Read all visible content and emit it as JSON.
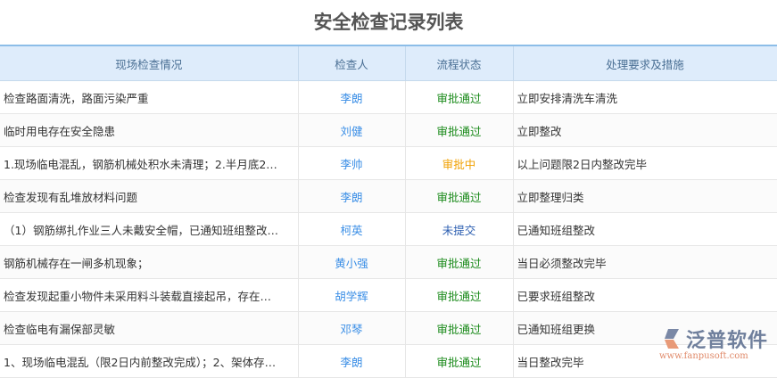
{
  "title": "安全检查记录列表",
  "columns": [
    "现场检查情况",
    "检查人",
    "流程状态",
    "处理要求及措施"
  ],
  "status_colors": {
    "审批通过": "#1a8a1a",
    "审批中": "#f0a000",
    "未提交": "#2a5db0"
  },
  "rows": [
    {
      "situation": "检查路面清洗，路面污染严重",
      "inspector": "李朗",
      "status": "审批通过",
      "measure": "立即安排清洗车清洗"
    },
    {
      "situation": "临时用电存在安全隐患",
      "inspector": "刘健",
      "status": "审批通过",
      "measure": "立即整改"
    },
    {
      "situation": "1.现场临电混乱，钢筋机械处积水未清理；2.半月底2…",
      "inspector": "李帅",
      "status": "审批中",
      "measure": "以上问题限2日内整改完毕"
    },
    {
      "situation": "检查发现有乱堆放材料问题",
      "inspector": "李朗",
      "status": "审批通过",
      "measure": "立即整理归类"
    },
    {
      "situation": "（1）钢筋绑扎作业三人未戴安全帽，已通知班组整改…",
      "inspector": "柯英",
      "status": "未提交",
      "measure": "已通知班组整改"
    },
    {
      "situation": "钢筋机械存在一闸多机现象；",
      "inspector": "黄小强",
      "status": "审批通过",
      "measure": "当日必须整改完毕"
    },
    {
      "situation": "检查发现起重小物件未采用料斗装载直接起吊，存在…",
      "inspector": "胡学辉",
      "status": "审批通过",
      "measure": "已要求班组整改"
    },
    {
      "situation": "检查临电有漏保部灵敏",
      "inspector": "邓琴",
      "status": "审批通过",
      "measure": "已通知班组更换"
    },
    {
      "situation": "1、现场临电混乱（限2日内前整改完成）；2、架体存…",
      "inspector": "李朗",
      "status": "审批通过",
      "measure": "当日整改完毕"
    }
  ],
  "logo": {
    "name": "泛普软件",
    "url": "www.fanpusoft.com"
  }
}
